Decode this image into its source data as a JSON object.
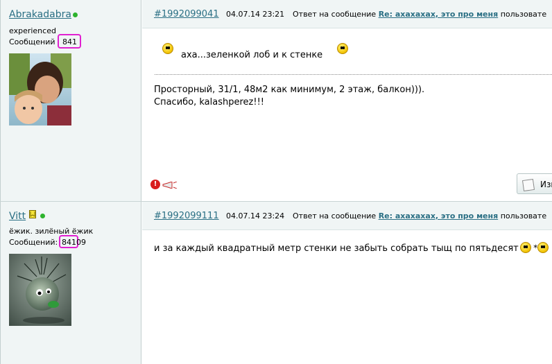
{
  "posts": [
    {
      "username": "Abrakadabra",
      "user_title": "experienced",
      "count_label": "Сообщений",
      "count_value": "841",
      "post_id": "#1992099041",
      "datetime": "04.07.14 23:21",
      "reply_prefix": "Ответ на сообщение",
      "reply_link": "Re: ахахахах, это про меня",
      "reply_suffix": "пользовате",
      "quote_text": "аха...зеленкой лоб и к стенке",
      "message_lines": [
        "Просторный, 31/1, 48м2 как минимум, 2 этаж, балкон))).",
        "Спасибо, kalashperez!!!"
      ],
      "edit_label": "Изм"
    },
    {
      "username": "Vitt",
      "user_title": "ёжик. зилёный ёжик",
      "count_label": "Сообщений:",
      "count_value": "84109",
      "count_highlight": "841",
      "count_rest": "09",
      "post_id": "#1992099111",
      "datetime": "04.07.14 23:24",
      "reply_prefix": "Ответ на сообщение",
      "reply_link": "Re: ахахахах, это про меня",
      "reply_suffix": "пользовате",
      "message": "и за каждый квадратный метр стенки не забыть собрать тыщ по пятьдесят"
    }
  ],
  "icons": {
    "online_status": "green-dot",
    "smiley": "smiley-emoticon",
    "warning": "exclamation-icon",
    "megaphone": "megaphone-icon",
    "edit": "pencil-icon",
    "badge": "book-badge-icon"
  },
  "colors": {
    "link": "#2a6f84",
    "highlight_border": "#e020d0",
    "sidebar_bg": "#f0f5f5",
    "online_dot": "#2db32d"
  }
}
